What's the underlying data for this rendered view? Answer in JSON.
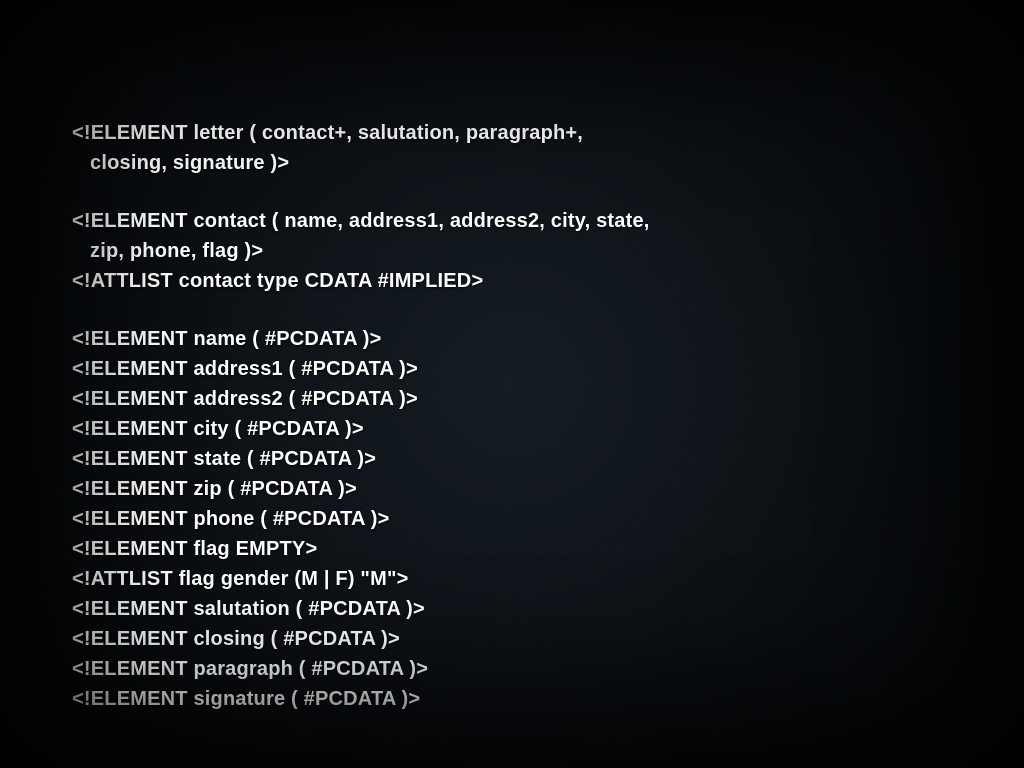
{
  "dtd": {
    "block1": {
      "l1": "<!ELEMENT letter ( contact+, salutation, paragraph+,",
      "l2": "closing, signature )>"
    },
    "block2": {
      "l1": "<!ELEMENT contact ( name, address1, address2, city, state,",
      "l2": "zip, phone, flag )>",
      "l3": "<!ATTLIST contact type CDATA #IMPLIED>"
    },
    "block3": {
      "l1": "<!ELEMENT name ( #PCDATA )>",
      "l2": "<!ELEMENT address1 ( #PCDATA )>",
      "l3": "<!ELEMENT address2 ( #PCDATA )>",
      "l4": "<!ELEMENT city ( #PCDATA )>",
      "l5": "<!ELEMENT state ( #PCDATA )>",
      "l6": "<!ELEMENT zip ( #PCDATA )>",
      "l7": "<!ELEMENT phone ( #PCDATA )>",
      "l8": "<!ELEMENT flag EMPTY>",
      "l9": "<!ATTLIST flag gender (M | F) \"M\">",
      "l10": "<!ELEMENT salutation ( #PCDATA )>",
      "l11": "<!ELEMENT closing ( #PCDATA )>",
      "l12": "<!ELEMENT paragraph ( #PCDATA )>",
      "l13": "<!ELEMENT signature ( #PCDATA )>"
    }
  }
}
